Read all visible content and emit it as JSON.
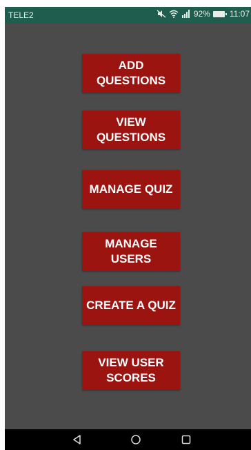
{
  "status_bar": {
    "carrier": "TELE2",
    "battery": "92%",
    "time": "11:07",
    "icons": [
      "mute-icon",
      "wifi-icon",
      "signal-icon",
      "battery-icon"
    ]
  },
  "menu": {
    "buttons": [
      {
        "label": "ADD\nQUESTIONS"
      },
      {
        "label": "VIEW\nQUESTIONS"
      },
      {
        "label": "MANAGE QUIZ"
      },
      {
        "label": "MANAGE\nUSERS"
      },
      {
        "label": "CREATE A QUIZ"
      },
      {
        "label": "VIEW USER\nSCORES"
      }
    ]
  },
  "nav_bar": {
    "icons": [
      "back-icon",
      "home-icon",
      "recent-apps-icon"
    ]
  },
  "colors": {
    "status_bar": "#1f5e4f",
    "background": "#4b4b4b",
    "button": "#9b1410",
    "button_text": "#ffffff",
    "nav_bar": "#000000"
  }
}
